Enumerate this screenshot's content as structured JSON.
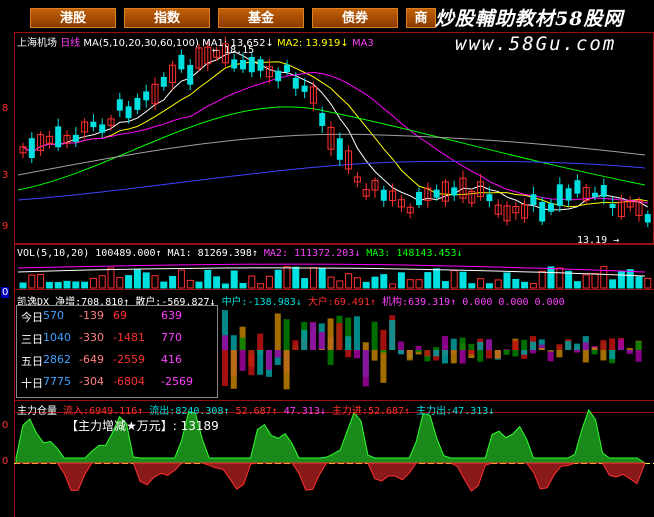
{
  "tabs": [
    {
      "label": "港股"
    },
    {
      "label": "指数"
    },
    {
      "label": "基金"
    },
    {
      "label": "债券"
    },
    {
      "label": "商"
    }
  ],
  "watermark": {
    "line1": "炒股輔助教材58股网",
    "line2": "www.58Gu.com"
  },
  "main_info": {
    "name": "上海机场",
    "period": "日线",
    "ma_params": "MA(5,10,20,30,60,100)",
    "ma1": "MA1: 13.652↓",
    "ma2": "MA2: 13.919↓",
    "ma3": "MA3"
  },
  "price_marks": {
    "high": "18.15",
    "low": "13.19"
  },
  "left_axis": [
    "8",
    "3",
    "9"
  ],
  "vol_info": {
    "params": "VOL(5,10,20)",
    "vol": "100489.000↑",
    "ma1": "MA1: 81269.398↑",
    "ma2": "MA2: 111372.203↓",
    "ma3": "MA3: 148143.453↓"
  },
  "dx_info": {
    "name": "凯逸DX",
    "net_label": "净增:",
    "net": "708.810↑",
    "retail_label": "散户:",
    "retail": "-569.827↓",
    "mid_label": "中户:",
    "mid": "-138.983↓",
    "big_label": "大户:",
    "big": "69.491↑",
    "inst_label": "机构:",
    "inst": "639.319↑",
    "zeros": "0.000 0.000 0.000"
  },
  "dx_left_mark": "0",
  "dx_table": [
    {
      "period": "今日",
      "v1": "570",
      "v2": "-139",
      "v3": "69",
      "v4": "639"
    },
    {
      "period": "三日",
      "v1": "1040",
      "v2": "-330",
      "v3": "-1481",
      "v4": "770"
    },
    {
      "period": "五日",
      "v1": "2862",
      "v2": "-649",
      "v3": "-2559",
      "v4": "416"
    },
    {
      "period": "十日",
      "v1": "7775",
      "v2": "-304",
      "v3": "-6804",
      "v4": "-2569"
    }
  ],
  "flow_info": {
    "name": "主力仓量",
    "in_label": "流入:",
    "in_val": "6949.116↑",
    "out_label": "流出:",
    "out_val": "8240.308↑",
    "v1": "52.687↑",
    "v2": "47.313↓",
    "in_pct_label": "主力进:",
    "in_pct": "52.687↑",
    "out_pct_label": "主力出:",
    "out_pct": "47.313↓"
  },
  "flow_box": {
    "title": "【主力增减★万元】:",
    "value": "13189"
  },
  "flow_left_axis": [
    "0",
    "0"
  ],
  "colors": {
    "up": "#ff3030",
    "down": "#00e0e0",
    "ma1": "#ffffff",
    "ma2": "#ffff00",
    "ma3": "#ff00ff",
    "ma4": "#00ff00",
    "ma5": "#a0a0a0",
    "ma6": "#4040ff",
    "tab_bg": "#a84a00",
    "grid": "#9a1010"
  }
}
